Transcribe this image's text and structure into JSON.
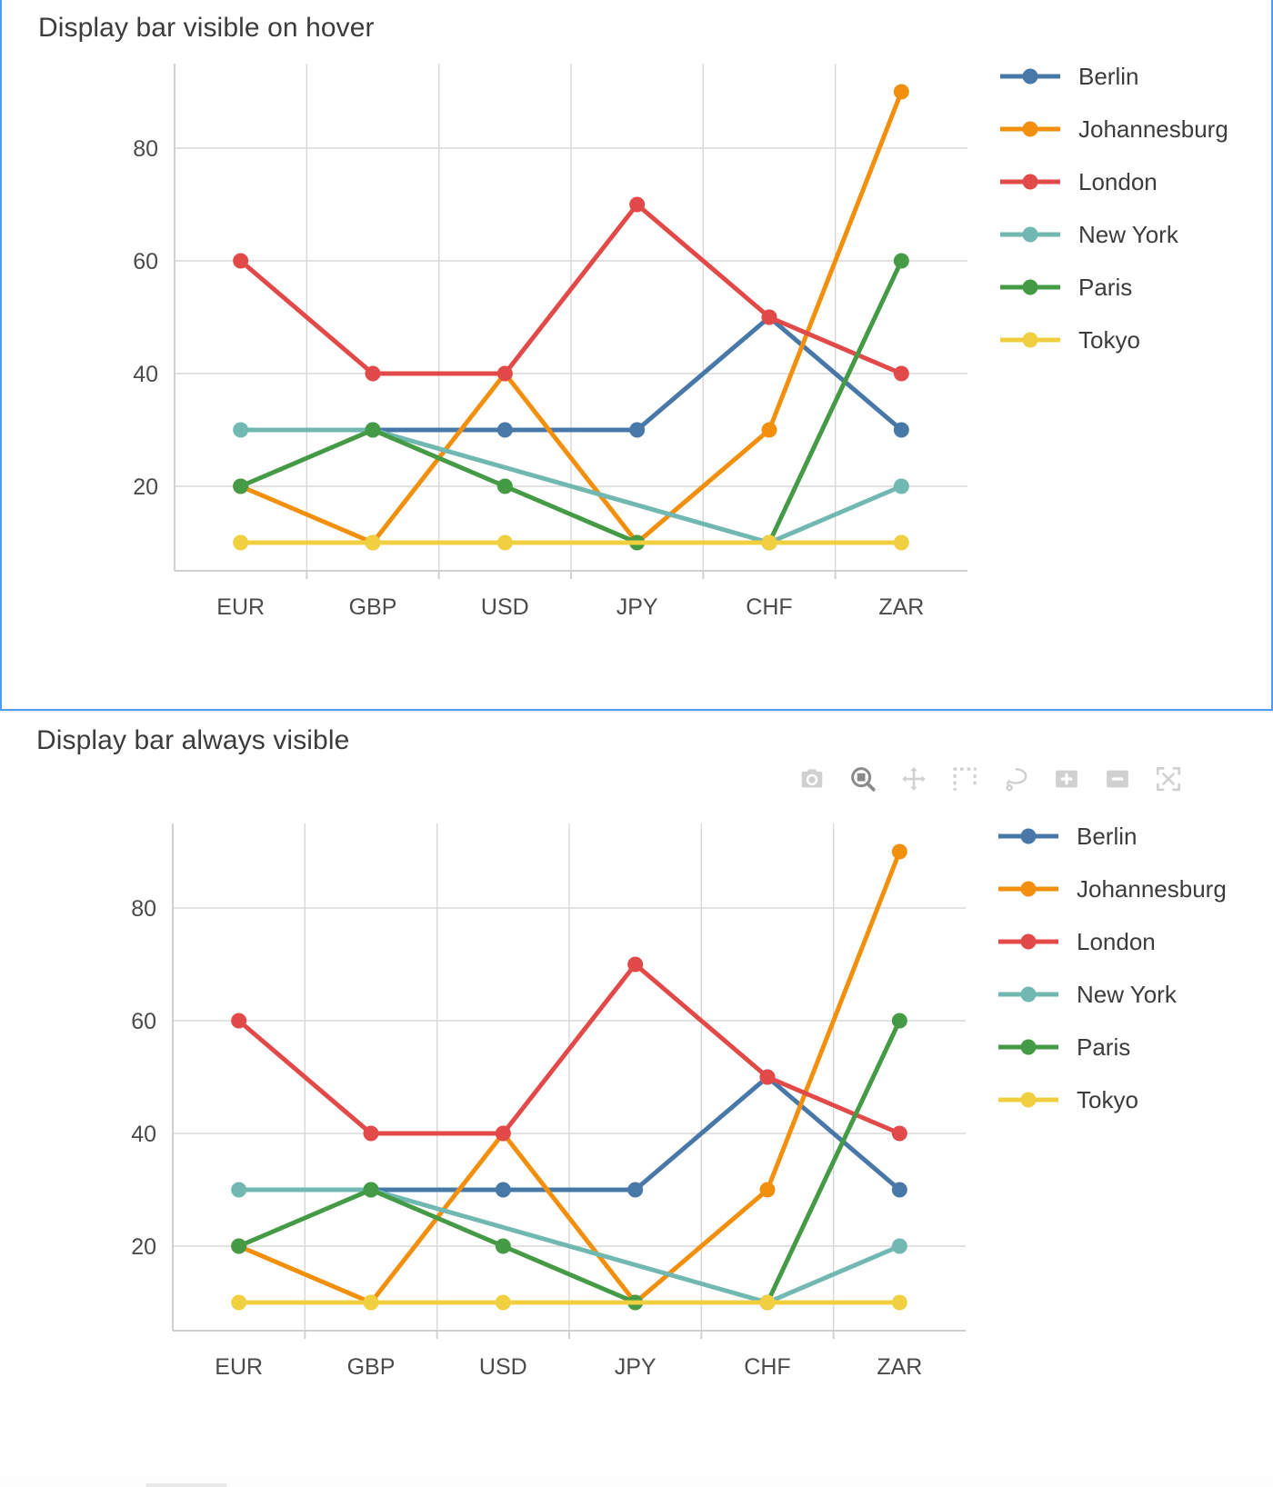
{
  "panels": [
    {
      "title": "Display bar visible on hover",
      "modebar_visible": false,
      "focused": true
    },
    {
      "title": "Display bar always visible",
      "modebar_visible": true,
      "focused": false
    }
  ],
  "modebar": {
    "buttons": [
      {
        "name": "camera-icon",
        "label": "Download plot as a png"
      },
      {
        "name": "zoom-icon",
        "label": "Zoom"
      },
      {
        "name": "pan-icon",
        "label": "Pan"
      },
      {
        "name": "box-select-icon",
        "label": "Box Select"
      },
      {
        "name": "lasso-select-icon",
        "label": "Lasso Select"
      },
      {
        "name": "zoom-in-icon",
        "label": "Zoom in"
      },
      {
        "name": "zoom-out-icon",
        "label": "Zoom out"
      },
      {
        "name": "autoscale-icon",
        "label": "Autoscale"
      }
    ],
    "color": "#c8c8c8",
    "color_active": "#777777"
  },
  "chart_data": {
    "type": "line",
    "title": "",
    "xlabel": "",
    "ylabel": "",
    "categories": [
      "EUR",
      "GBP",
      "USD",
      "JPY",
      "CHF",
      "ZAR"
    ],
    "yticks": [
      20,
      40,
      60,
      80
    ],
    "ylim": [
      5,
      95
    ],
    "grid": true,
    "legend_position": "right",
    "series": [
      {
        "name": "Berlin",
        "color": "#4878a8",
        "values": [
          null,
          30,
          30,
          30,
          50,
          30
        ]
      },
      {
        "name": "Johannesburg",
        "color": "#f2900d",
        "values": [
          20,
          10,
          40,
          10,
          30,
          90
        ]
      },
      {
        "name": "London",
        "color": "#e24a4a",
        "values": [
          60,
          40,
          40,
          70,
          50,
          40
        ]
      },
      {
        "name": "New York",
        "color": "#72b8b2",
        "values": [
          30,
          30,
          null,
          null,
          10,
          20
        ]
      },
      {
        "name": "Paris",
        "color": "#459a45",
        "values": [
          20,
          30,
          20,
          10,
          10,
          60
        ]
      },
      {
        "name": "Tokyo",
        "color": "#f0d040",
        "values": [
          10,
          10,
          10,
          null,
          10,
          10
        ]
      }
    ]
  }
}
